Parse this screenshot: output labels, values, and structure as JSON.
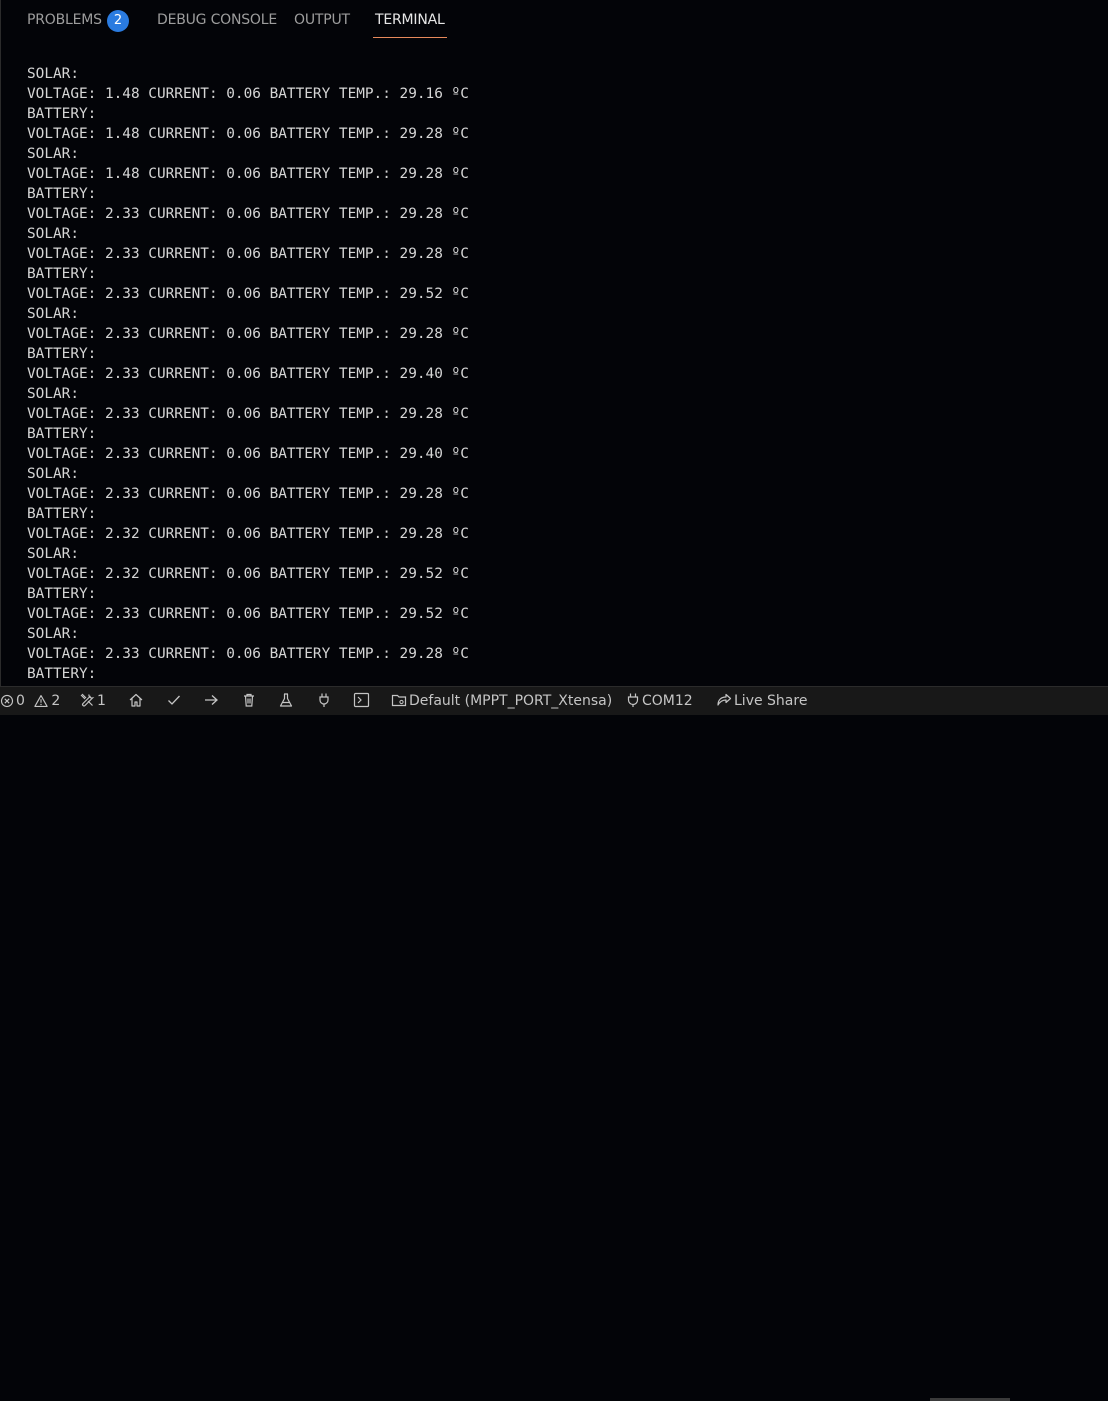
{
  "panel_tabs": [
    {
      "label": "PROBLEMS",
      "active": false
    },
    {
      "label": "DEBUG CONSOLE",
      "active": false
    },
    {
      "label": "OUTPUT",
      "active": false
    },
    {
      "label": "TERMINAL",
      "active": true
    }
  ],
  "problems_count": "2",
  "terminal_lines": [
    "SOLAR:",
    "VOLTAGE: 1.48 CURRENT: 0.06 BATTERY TEMP.: 29.16 ºC",
    "BATTERY:",
    "VOLTAGE: 1.48 CURRENT: 0.06 BATTERY TEMP.: 29.28 ºC",
    "SOLAR:",
    "VOLTAGE: 1.48 CURRENT: 0.06 BATTERY TEMP.: 29.28 ºC",
    "BATTERY:",
    "VOLTAGE: 2.33 CURRENT: 0.06 BATTERY TEMP.: 29.28 ºC",
    "SOLAR:",
    "VOLTAGE: 2.33 CURRENT: 0.06 BATTERY TEMP.: 29.28 ºC",
    "BATTERY:",
    "VOLTAGE: 2.33 CURRENT: 0.06 BATTERY TEMP.: 29.52 ºC",
    "SOLAR:",
    "VOLTAGE: 2.33 CURRENT: 0.06 BATTERY TEMP.: 29.28 ºC",
    "BATTERY:",
    "VOLTAGE: 2.33 CURRENT: 0.06 BATTERY TEMP.: 29.40 ºC",
    "SOLAR:",
    "VOLTAGE: 2.33 CURRENT: 0.06 BATTERY TEMP.: 29.28 ºC",
    "BATTERY:",
    "VOLTAGE: 2.33 CURRENT: 0.06 BATTERY TEMP.: 29.40 ºC",
    "SOLAR:",
    "VOLTAGE: 2.33 CURRENT: 0.06 BATTERY TEMP.: 29.28 ºC",
    "BATTERY:",
    "VOLTAGE: 2.32 CURRENT: 0.06 BATTERY TEMP.: 29.28 ºC",
    "SOLAR:",
    "VOLTAGE: 2.32 CURRENT: 0.06 BATTERY TEMP.: 29.52 ºC",
    "BATTERY:",
    "VOLTAGE: 2.33 CURRENT: 0.06 BATTERY TEMP.: 29.52 ºC",
    "SOLAR:",
    "VOLTAGE: 2.33 CURRENT: 0.06 BATTERY TEMP.: 29.28 ºC",
    "BATTERY:"
  ],
  "statusbar": {
    "errors": "0",
    "warnings": "2",
    "tools_count": "1",
    "environment": "Default (MPPT_PORT_Xtensa)",
    "port": "COM12",
    "live_share": "Live Share",
    "icons": [
      "error-icon",
      "warning-icon",
      "tools-icon",
      "home-icon",
      "check-icon",
      "arrow-right-icon",
      "trash-icon",
      "flask-icon",
      "plug-icon",
      "terminal-icon",
      "folder-env-icon",
      "plug-port-icon",
      "live-share-icon"
    ]
  },
  "colors": {
    "background": "#030408",
    "active_tab_underline": "#e7895b",
    "badge": "#2a7be0",
    "statusbar": "#181818"
  }
}
